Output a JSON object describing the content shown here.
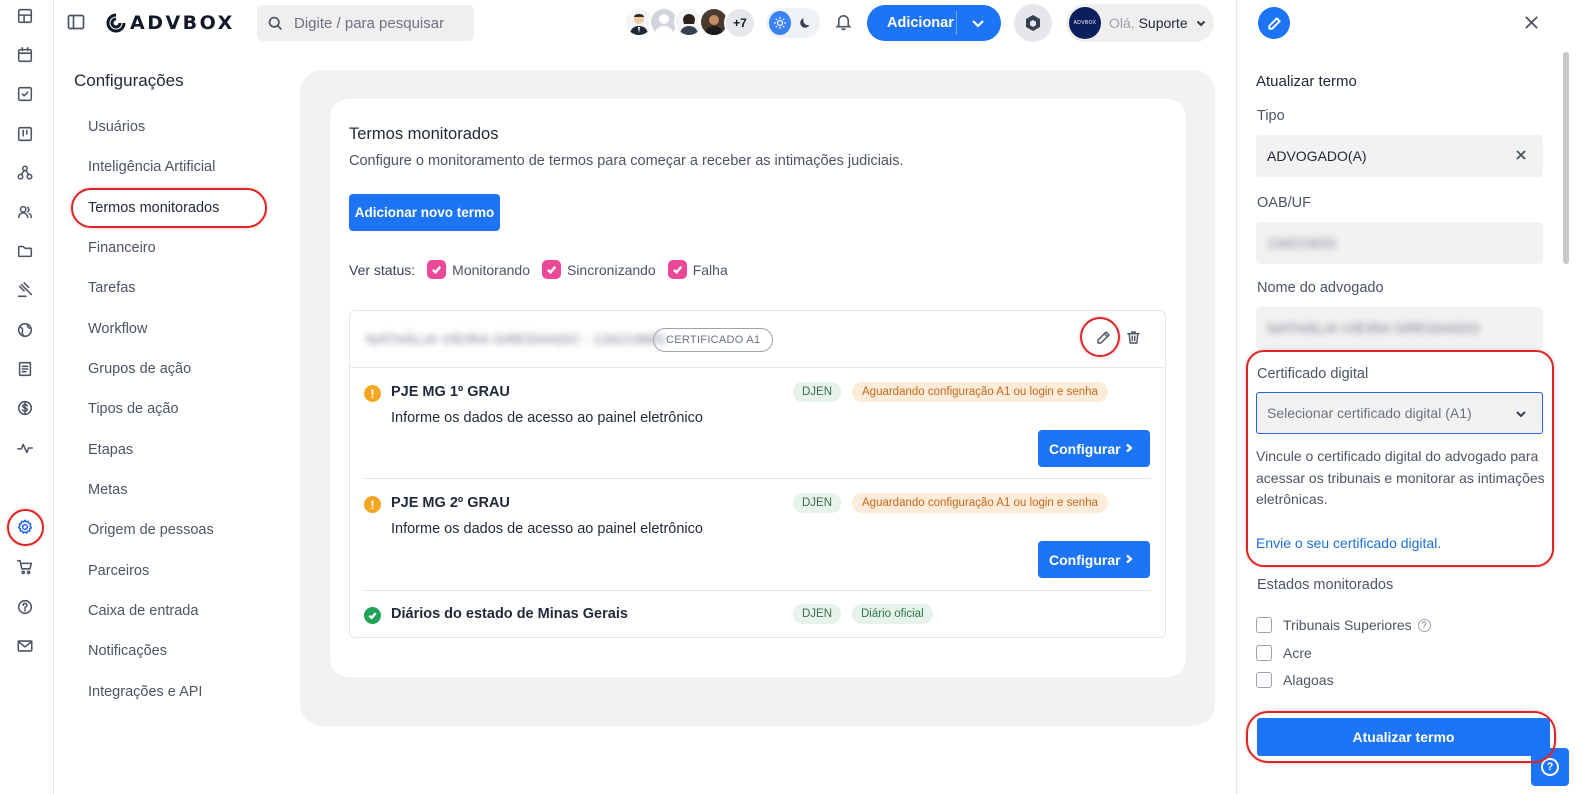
{
  "app": {
    "logo_text": "ADVBOX"
  },
  "search": {
    "placeholder": "Digite / para pesquisar"
  },
  "header": {
    "avatars_more": "+7",
    "add_label": "Adicionar",
    "user_avatar_text": "ADVBOX",
    "greeting": "Olá,",
    "user_name": "Suporte"
  },
  "settings": {
    "title": "Configurações",
    "items": [
      {
        "label": "Usuários"
      },
      {
        "label": "Inteligência Artificial"
      },
      {
        "label": "Termos monitorados",
        "active": true
      },
      {
        "label": "Financeiro"
      },
      {
        "label": "Tarefas"
      },
      {
        "label": "Workflow"
      },
      {
        "label": "Grupos de ação"
      },
      {
        "label": "Tipos de ação"
      },
      {
        "label": "Etapas"
      },
      {
        "label": "Metas"
      },
      {
        "label": "Origem de pessoas"
      },
      {
        "label": "Parceiros"
      },
      {
        "label": "Caixa de entrada"
      },
      {
        "label": "Notificações"
      },
      {
        "label": "Integrações e API"
      }
    ]
  },
  "main": {
    "title": "Termos monitorados",
    "subtitle": "Configure o monitoramento de termos para começar a receber as intimações judiciais.",
    "add_term_label": "Adicionar novo termo",
    "status_label": "Ver status:",
    "status_filters": [
      {
        "label": "Monitorando",
        "checked": true
      },
      {
        "label": "Sincronizando",
        "checked": true
      },
      {
        "label": "Falha",
        "checked": true
      }
    ],
    "term": {
      "name": "NATHÁLIA VIEIRA GREGHADO - 134219MG",
      "badge": "CERTIFICADO A1",
      "tribunals": [
        {
          "status": "warning",
          "name": "PJE MG 1º GRAU",
          "description": "Informe os dados de acesso ao painel eletrônico",
          "tag_source": "DJEN",
          "tag_status": "Aguardando configuração A1 ou login e senha",
          "button_label": "Configurar"
        },
        {
          "status": "warning",
          "name": "PJE MG 2º GRAU",
          "description": "Informe os dados de acesso ao painel eletrônico",
          "tag_source": "DJEN",
          "tag_status": "Aguardando configuração A1 ou login e senha",
          "button_label": "Configurar"
        },
        {
          "status": "ok",
          "name": "Diários do estado de Minas Gerais",
          "tag_source": "DJEN",
          "tag_status": "Diário oficial"
        }
      ]
    }
  },
  "drawer": {
    "title": "Atualizar termo",
    "type_label": "Tipo",
    "type_value": "ADVOGADO(A)",
    "oab_label": "OAB/UF",
    "oab_value": "1342192G",
    "lawyer_label": "Nome do advogado",
    "lawyer_value": "NATHÁLIA VIEIRA GREGHADO",
    "cert_label": "Certificado digital",
    "cert_placeholder": "Selecionar certificado digital (A1)",
    "cert_help": "Vincule o certificado digital do advogado para acessar os tribunais e monitorar as intimações eletrônicas.",
    "cert_link": "Envie o seu certificado digital.",
    "states_label": "Estados monitorados",
    "states": [
      {
        "label": "Tribunais Superiores",
        "checked": false,
        "has_info": true
      },
      {
        "label": "Acre",
        "checked": false
      },
      {
        "label": "Alagoas",
        "checked": false
      }
    ],
    "submit_label": "Atualizar termo"
  },
  "rail": {
    "icons": [
      "dashboard-icon",
      "calendar-icon",
      "tasks-icon",
      "kanban-icon",
      "workflow-icon",
      "people-icon",
      "folder-icon",
      "gavel-icon",
      "globe-icon",
      "book-icon",
      "money-icon",
      "activity-icon",
      "settings-icon",
      "cart-icon",
      "help-icon",
      "mail-icon"
    ],
    "active": "settings-icon"
  },
  "colors": {
    "primary": "#1d74f5",
    "accent_pink": "#ec4899",
    "warning": "#f5a623",
    "success": "#22a35a",
    "annotation_red": "#dc2626"
  }
}
